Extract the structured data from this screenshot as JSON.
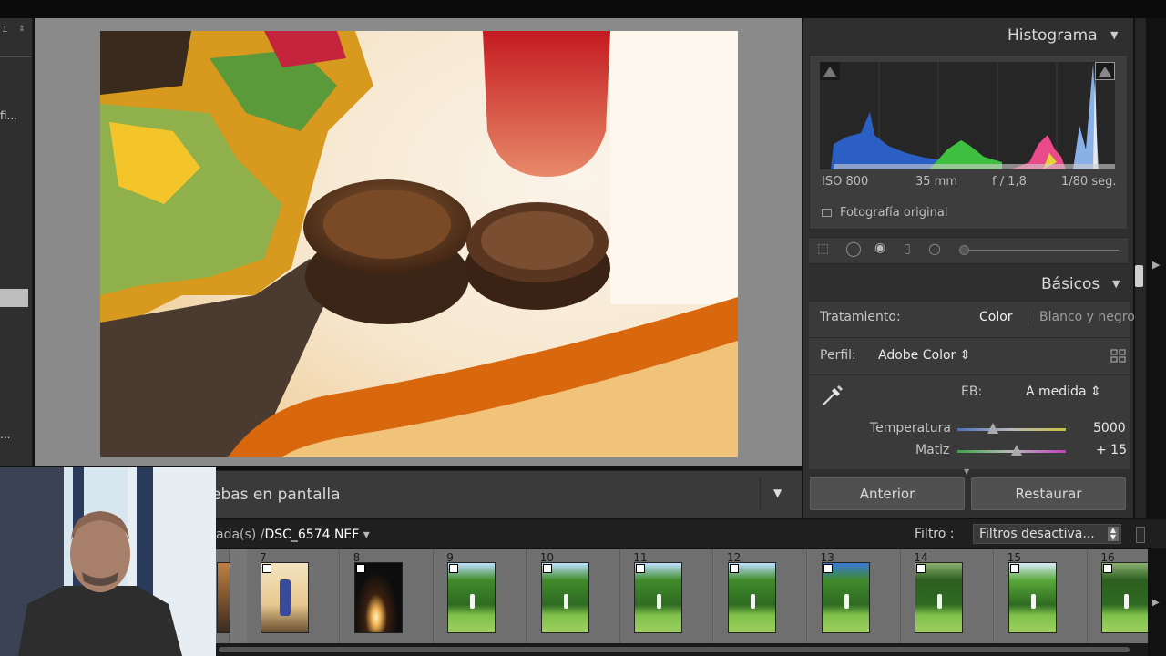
{
  "left_panel": {
    "spinner_value": "1",
    "spinner_arrows": "⇕",
    "truncated_item": "fi...",
    "truncated_bottom": "..."
  },
  "toolbar": {
    "label": "ebas en pantalla",
    "menu_icon": "chevron-down-icon"
  },
  "histogram": {
    "title": "Histograma",
    "iso": "ISO 800",
    "focal": "35 mm",
    "aperture": "f / 1,8",
    "shutter": "1/80 seg.",
    "original_photo_label": "Fotografía original"
  },
  "basicos": {
    "title": "Básicos",
    "tratamiento_label": "Tratamiento:",
    "tratamiento_color": "Color",
    "tratamiento_bw": "Blanco y negro",
    "perfil_label": "Perfil:",
    "perfil_value": "Adobe Color ⇕",
    "eb_label": "EB:",
    "eb_value": "A medida ⇕",
    "temperatura_label": "Temperatura",
    "temperatura_value": "5000",
    "temperatura_level": 0.33,
    "matiz_label": "Matiz",
    "matiz_value": "+ 15",
    "matiz_level": 0.55
  },
  "buttons": {
    "anterior": "Anterior",
    "restaurar": "Restaurar"
  },
  "filmstrip": {
    "path_prefix": "ada(s) /",
    "file_name": "DSC_6574.NEF",
    "file_menu_icon": "▾",
    "filter_label": "Filtro :",
    "filter_value": "Filtros desactiva...",
    "cells": [
      {
        "num": "",
        "kind": "partial"
      },
      {
        "num": "7",
        "kind": "bottle"
      },
      {
        "num": "8",
        "kind": "candle"
      },
      {
        "num": "9",
        "kind": "garden"
      },
      {
        "num": "10",
        "kind": "garden"
      },
      {
        "num": "11",
        "kind": "garden"
      },
      {
        "num": "12",
        "kind": "garden"
      },
      {
        "num": "13",
        "kind": "garden-sky"
      },
      {
        "num": "14",
        "kind": "garden-dark"
      },
      {
        "num": "15",
        "kind": "garden-bright"
      },
      {
        "num": "16",
        "kind": "garden-dark"
      }
    ]
  },
  "colors": {
    "panel": "#2f2f2f",
    "center_bg": "#8a8a8a",
    "filmstrip_bg": "#777777"
  }
}
